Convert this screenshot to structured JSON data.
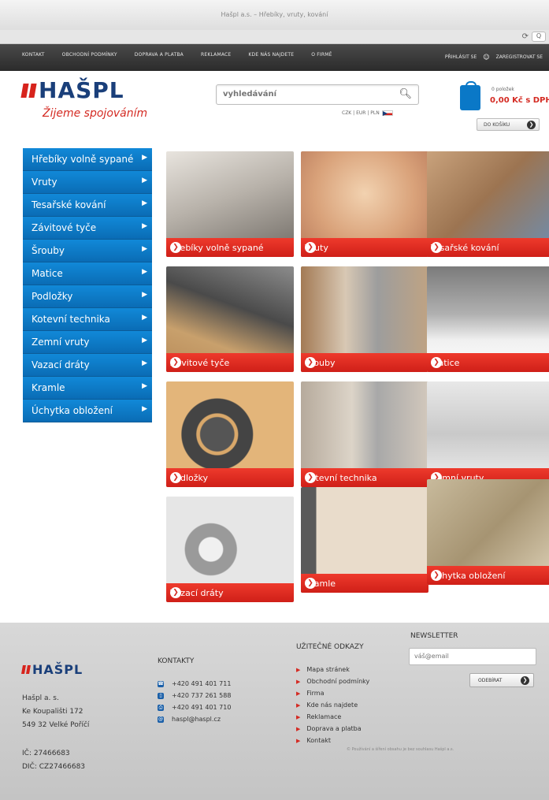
{
  "browser": {
    "title": "Hašpl a.s. – Hřebíky, vruty, kování",
    "reload_icon": "reload-icon",
    "search_icon": "search-icon"
  },
  "topnav": {
    "links": [
      "KONTAKT",
      "OBCHODNÍ PODMÍNKY",
      "DOPRAVA A PLATBA",
      "REKLAMACE",
      "KDE NÁS NAJDETE",
      "O FIRMĚ"
    ],
    "login": "PŘIHLÁSIT SE",
    "register": "ZAREGISTROVAT SE"
  },
  "header": {
    "logo_text": "HAŠPL",
    "slogan": "Žijeme spojováním",
    "search_placeholder": "vyhledávání",
    "currency": "CZK | EUR | PLN",
    "cart_items": "0 položek",
    "cart_price": "0,00 Kč s DPH",
    "cart_button": "DO KOŠÍKU"
  },
  "sidebar": {
    "items": [
      {
        "label": "Hřebíky volně sypané"
      },
      {
        "label": "Vruty"
      },
      {
        "label": "Tesařské kování"
      },
      {
        "label": "Závitové tyče"
      },
      {
        "label": "Šrouby"
      },
      {
        "label": "Matice"
      },
      {
        "label": "Podložky"
      },
      {
        "label": "Kotevní technika"
      },
      {
        "label": "Zemní vruty"
      },
      {
        "label": "Vazací dráty"
      },
      {
        "label": "Kramle"
      },
      {
        "label": "Úchytka obložení"
      }
    ]
  },
  "tiles": [
    {
      "label": "Hřebíky volně sypané"
    },
    {
      "label": "Vruty"
    },
    {
      "label": "Tesařské kování"
    },
    {
      "label": "Závitové tyče"
    },
    {
      "label": "Šrouby"
    },
    {
      "label": "Matice"
    },
    {
      "label": "Podložky"
    },
    {
      "label": "Kotevní technika"
    },
    {
      "label": "Zemní vruty"
    },
    {
      "label": "Vazací dráty"
    },
    {
      "label": "Kramle"
    },
    {
      "label": "Úchytka obložení"
    }
  ],
  "footer": {
    "logo_text": "HAŠPL",
    "company": "Hašpl a. s.",
    "street": "Ke Koupališti 172",
    "city": "549 32 Velké Poříčí",
    "ico": "IČ: 27466683",
    "dic": "DIČ: CZ27466683",
    "contacts_heading": "KONTAKTY",
    "contacts": [
      "+420 491 401 711",
      "+420 737 261 588",
      "+420 491 401 710",
      "haspl@haspl.cz"
    ],
    "links_heading": "UŽITEČNÉ ODKAZY",
    "links": [
      "Mapa stránek",
      "Obchodní podmínky",
      "Firma",
      "Kde nás najdete",
      "Reklamace",
      "Doprava a platba",
      "Kontakt"
    ],
    "newsletter_heading": "NEWSLETTER",
    "newsletter_placeholder": "váš@email",
    "subscribe": "ODEBÍRAT",
    "copyright": "© Používání a šíření obsahu je bez souhlasu Hašpl a.s."
  },
  "colors": {
    "brand_blue": "#1a3f7a",
    "brand_red": "#d42a22",
    "sidebar_blue": "#0a78c7"
  }
}
